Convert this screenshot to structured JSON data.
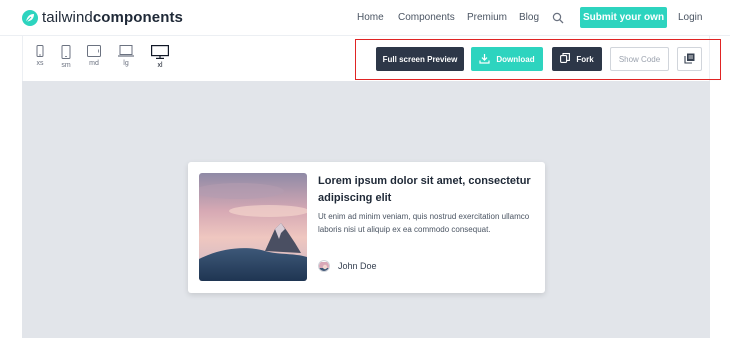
{
  "brand": {
    "name_light": "tailwind",
    "name_bold": "components",
    "accent": "#2dd4bf",
    "logo_icon": "leaf-icon"
  },
  "nav": {
    "links": [
      "Home",
      "Components",
      "Premium",
      "Blog"
    ],
    "search_icon": "search-icon",
    "submit_label": "Submit your own",
    "login_label": "Login"
  },
  "devices": [
    {
      "label": "xs",
      "icon": "phone-small-icon",
      "active": false
    },
    {
      "label": "sm",
      "icon": "phone-icon",
      "active": false
    },
    {
      "label": "md",
      "icon": "tablet-icon",
      "active": false
    },
    {
      "label": "lg",
      "icon": "laptop-icon",
      "active": false
    },
    {
      "label": "xl",
      "icon": "desktop-icon",
      "active": true
    }
  ],
  "toolbar": {
    "preview_label": "Full screen  Preview",
    "download_label": "Download",
    "fork_label": "Fork",
    "show_code_label": "Show Code",
    "copy_icon": "copy-icon",
    "dark": "#2d3748",
    "highlight": "#e02424"
  },
  "card": {
    "title": "Lorem ipsum dolor sit amet, consectetur adipiscing elit",
    "description": "Ut enim ad minim veniam, quis nostrud exercitation ullamco laboris nisi ut aliquip ex ea commodo consequat.",
    "author": "John Doe"
  }
}
